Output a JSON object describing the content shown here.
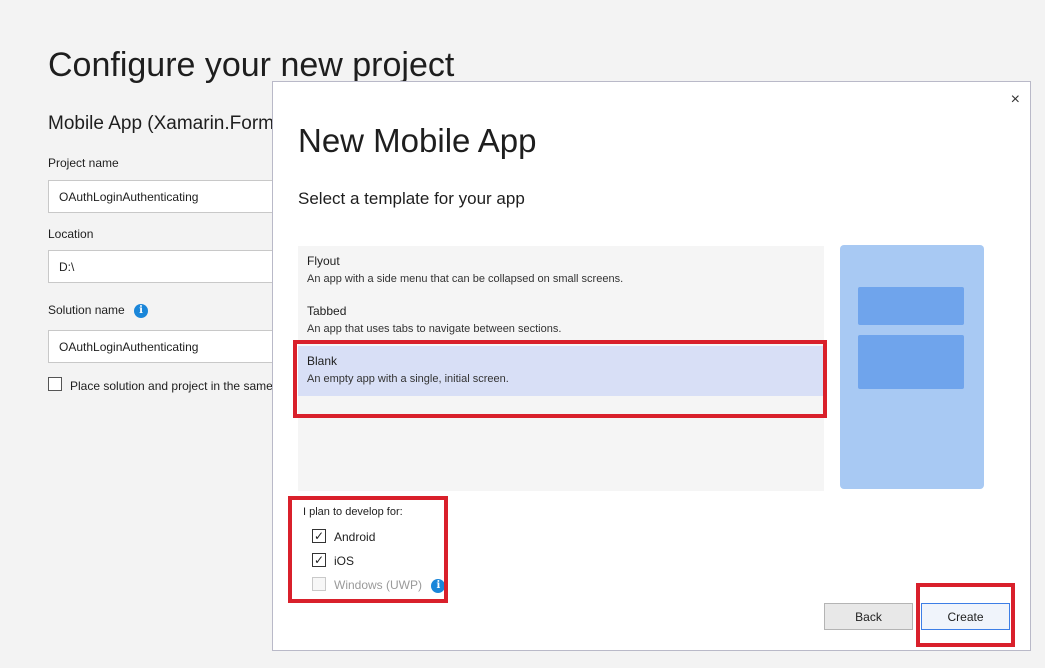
{
  "background": {
    "title": "Configure your new project",
    "subtitle": "Mobile App (Xamarin.Forms)",
    "project_name_label": "Project name",
    "project_name_value": "OAuthLoginAuthenticating",
    "location_label": "Location",
    "location_value": "D:\\",
    "solution_name_label": "Solution name",
    "solution_name_value": "OAuthLoginAuthenticating",
    "place_same_dir_label": "Place solution and project in the same directory",
    "info_icon": "i"
  },
  "dialog": {
    "close_icon": "×",
    "title": "New Mobile App",
    "subtitle": "Select a template for your app",
    "templates": [
      {
        "name": "Flyout",
        "description": "An app with a side menu that can be collapsed on small screens.",
        "selected": false
      },
      {
        "name": "Tabbed",
        "description": "An app that uses tabs to navigate between sections.",
        "selected": false
      },
      {
        "name": "Blank",
        "description": "An empty app with a single, initial screen.",
        "selected": true
      }
    ],
    "platform_label": "I plan to develop for:",
    "platforms": [
      {
        "label": "Android",
        "checked": true,
        "enabled": true
      },
      {
        "label": "iOS",
        "checked": true,
        "enabled": true
      },
      {
        "label": "Windows (UWP)",
        "checked": false,
        "enabled": false
      }
    ],
    "check_mark": "✓",
    "info_icon": "i",
    "back_label": "Back",
    "create_label": "Create"
  },
  "colors": {
    "highlight": "#d9202b",
    "selected_row": "#d8dff6",
    "preview_bg": "#a8c9f3",
    "preview_block": "#6fa4ec",
    "info_blue": "#1a86d9"
  }
}
